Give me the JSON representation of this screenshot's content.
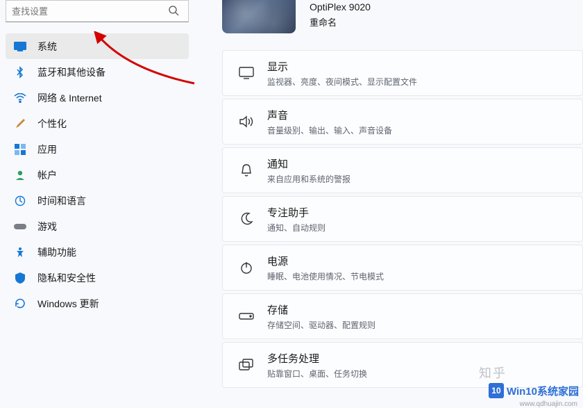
{
  "search": {
    "placeholder": "查找设置"
  },
  "sidebar": {
    "items": [
      {
        "label": "系统"
      },
      {
        "label": "蓝牙和其他设备"
      },
      {
        "label": "网络 & Internet"
      },
      {
        "label": "个性化"
      },
      {
        "label": "应用"
      },
      {
        "label": "帐户"
      },
      {
        "label": "时间和语言"
      },
      {
        "label": "游戏"
      },
      {
        "label": "辅助功能"
      },
      {
        "label": "隐私和安全性"
      },
      {
        "label": "Windows 更新"
      }
    ]
  },
  "device": {
    "name": "OptiPlex 9020",
    "rename": "重命名"
  },
  "cards": [
    {
      "title": "显示",
      "subtitle": "监视器、亮度、夜间模式、显示配置文件"
    },
    {
      "title": "声音",
      "subtitle": "音量级别、输出、输入、声音设备"
    },
    {
      "title": "通知",
      "subtitle": "来自应用和系统的警报"
    },
    {
      "title": "专注助手",
      "subtitle": "通知、自动规则"
    },
    {
      "title": "电源",
      "subtitle": "睡眠、电池使用情况、节电模式"
    },
    {
      "title": "存储",
      "subtitle": "存储空间、驱动器、配置规则"
    },
    {
      "title": "多任务处理",
      "subtitle": "贴靠窗口、桌面、任务切换"
    }
  ],
  "watermarks": {
    "zhihu": "知乎",
    "brand_logo": "10",
    "brand": "Win10系统家园",
    "url": "www.qdhuajin.com"
  }
}
